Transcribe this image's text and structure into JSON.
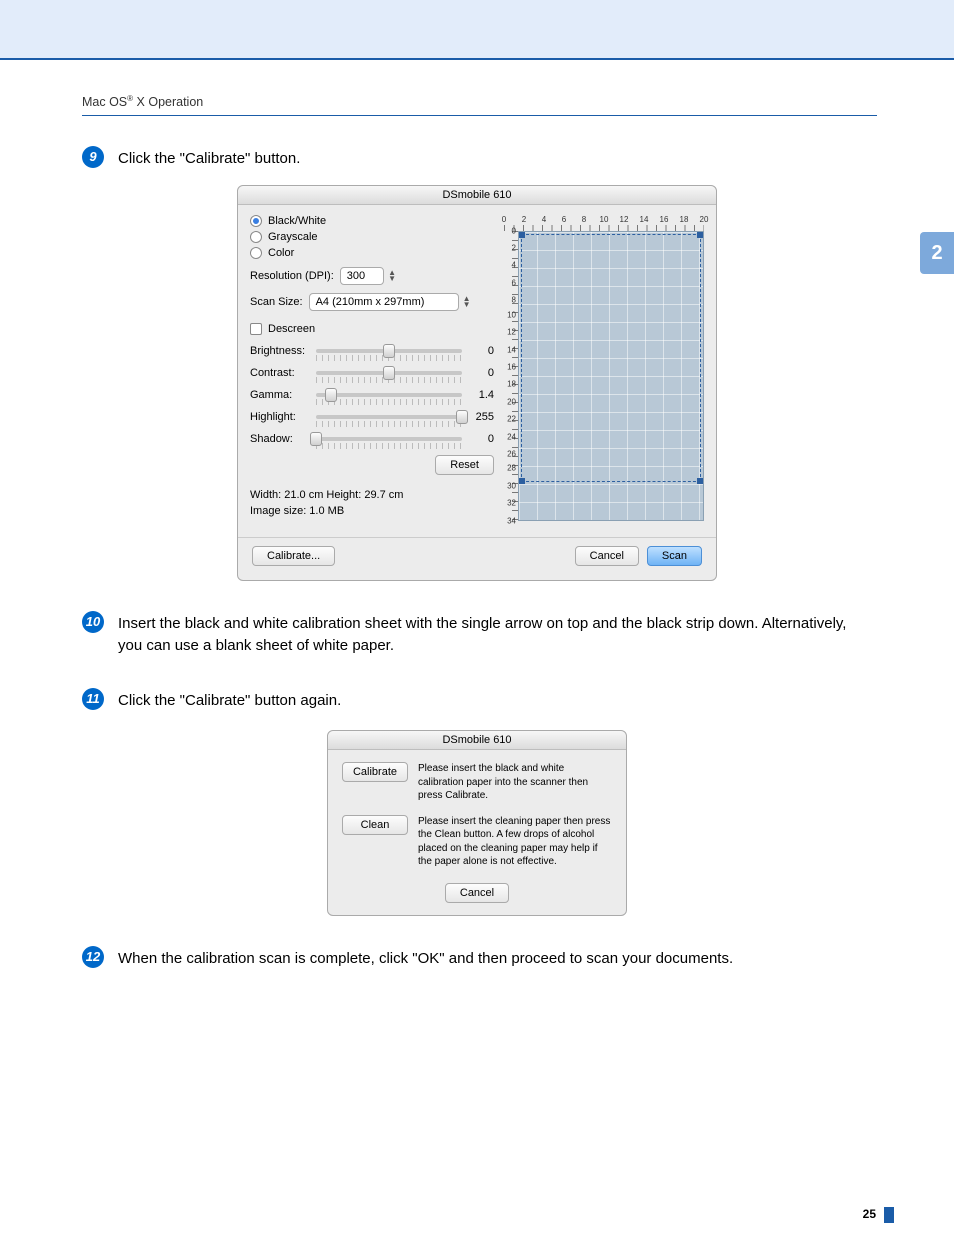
{
  "header": {
    "text_before": "Mac OS",
    "sup": "®",
    "text_after": " X Operation"
  },
  "side_tab": "2",
  "page_number": "25",
  "steps": {
    "s9": {
      "num": "9",
      "text": "Click the \"Calibrate\" button."
    },
    "s10": {
      "num": "10",
      "text": "Insert the black and white calibration sheet with the single arrow on top and the black strip down. Alternatively, you can use a blank sheet of white paper."
    },
    "s11": {
      "num": "11",
      "text": "Click the \"Calibrate\" button again."
    },
    "s12": {
      "num": "12",
      "text": "When the calibration scan is complete, click \"OK\" and then proceed to scan your documents."
    }
  },
  "dialog1": {
    "title": "DSmobile 610",
    "radios": {
      "bw": "Black/White",
      "gray": "Grayscale",
      "color": "Color"
    },
    "resolution_label": "Resolution (DPI):",
    "resolution_value": "300",
    "scan_size_label": "Scan Size:",
    "scan_size_value": "A4 (210mm x 297mm)",
    "descreen": "Descreen",
    "sliders": {
      "brightness": {
        "label": "Brightness:",
        "value": "0",
        "pos": 50
      },
      "contrast": {
        "label": "Contrast:",
        "value": "0",
        "pos": 50
      },
      "gamma": {
        "label": "Gamma:",
        "value": "1.4",
        "pos": 10
      },
      "highlight": {
        "label": "Highlight:",
        "value": "255",
        "pos": 100
      },
      "shadow": {
        "label": "Shadow:",
        "value": "0",
        "pos": 0
      }
    },
    "reset": "Reset",
    "info_wh": "Width: 21.0 cm   Height: 29.7 cm",
    "info_size": "Image size: 1.0 MB",
    "calibrate": "Calibrate...",
    "cancel": "Cancel",
    "scan": "Scan",
    "ruler_h": [
      "0",
      "2",
      "4",
      "6",
      "8",
      "10",
      "12",
      "14",
      "16",
      "18",
      "20"
    ],
    "ruler_v": [
      "0",
      "2",
      "4",
      "6",
      "8",
      "10",
      "12",
      "14",
      "16",
      "18",
      "20",
      "22",
      "24",
      "26",
      "28",
      "30",
      "32",
      "34"
    ]
  },
  "dialog2": {
    "title": "DSmobile 610",
    "calibrate_btn": "Calibrate",
    "calibrate_text": "Please insert the black and white calibration paper into the scanner then press Calibrate.",
    "clean_btn": "Clean",
    "clean_text": "Please insert the cleaning paper then press the Clean button. A few drops of alcohol placed on the cleaning paper may help if the paper alone is not effective.",
    "cancel": "Cancel"
  }
}
